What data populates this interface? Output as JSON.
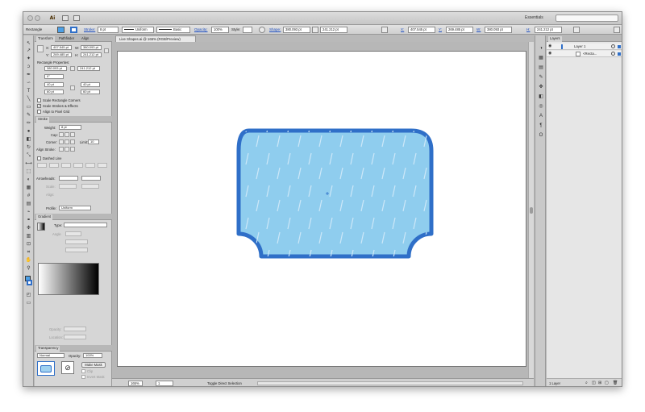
{
  "app": {
    "title_icon": "Ai",
    "workspace": "Essentials",
    "document_tab": "Live Shapes.ai @ 165% (RGB/Preview)"
  },
  "control_bar": {
    "selection_label": "Rectangle",
    "stroke_label": "Stroke:",
    "stroke_weight": "8 pt",
    "profile_value": "Uniform",
    "brush_value": "Basic",
    "opacity_label": "Opacity:",
    "opacity_value": "100%",
    "style_label": "Style:",
    "shape_label": "Shape:",
    "shape_w": "380.093 pt",
    "shape_h": "241.212 pt",
    "x_label": "X:",
    "x_value": "407.545 pt",
    "y_label": "Y:",
    "y_value": "269.485 pt",
    "w_label": "W:",
    "w_value": "380.093 pt",
    "h_label": "H:",
    "h_value": "241.212 pt",
    "fill_color": "#4da0e6",
    "stroke_color": "#2f6fc8"
  },
  "transform_panel": {
    "tabs": [
      "Transform",
      "Pathfinder",
      "Align"
    ],
    "x_label": "X:",
    "x_value": "407.545 pt",
    "w_label": "W:",
    "w_value": "380.093 pt",
    "y_label": "Y:",
    "y_value": "269.485 pt",
    "h_label": "H:",
    "h_value": "241.212 pt",
    "rect_props_label": "Rectangle Properties:",
    "rp_w": "380.093 pt",
    "rp_h": "241.212 pt",
    "rotate": "0°",
    "corner_tl": "40 pt",
    "corner_tr": "40 pt",
    "corner_bl": "60 pt",
    "corner_br": "60 pt",
    "scale_corners": "Scale Rectangle Corners",
    "scale_strokes": "Scale Strokes & Effects",
    "align_pixel": "Align to Pixel Grid"
  },
  "stroke_panel": {
    "title": "Stroke",
    "weight_label": "Weight:",
    "weight_value": "8 pt",
    "cap_label": "Cap:",
    "corner_label": "Corner:",
    "limit_label": "Limit:",
    "limit_value": "10",
    "align_label": "Align Stroke:",
    "dashed_label": "Dashed Line",
    "arrowheads_label": "Arrowheads:",
    "scale_label": "Scale:",
    "align2_label": "Align:",
    "profile_label": "Profile:",
    "profile_value": "Uniform"
  },
  "gradient_panel": {
    "title": "Gradient",
    "type_label": "Type:",
    "angle_label": "Angle",
    "opacity_label": "Opacity:",
    "location_label": "Location:"
  },
  "transparency_panel": {
    "title": "Transparency",
    "mode": "Normal",
    "opacity_label": "Opacity:",
    "opacity_value": "100%",
    "make_mask": "Make Mask",
    "clip": "Clip",
    "invert": "Invert Mask"
  },
  "status_bar": {
    "zoom": "165%",
    "artboard": "1",
    "tool": "Toggle Direct Selection"
  },
  "layers_panel": {
    "title": "Layers",
    "layers": [
      {
        "name": "Layer 1"
      },
      {
        "name": "<Recta..."
      }
    ],
    "footer": "1 Layer"
  }
}
